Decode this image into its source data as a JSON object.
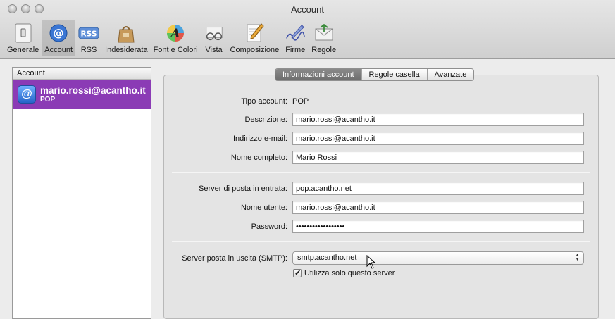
{
  "window": {
    "title": "Account"
  },
  "toolbar": {
    "items": [
      {
        "label": "Generale",
        "icon": "light-switch-icon"
      },
      {
        "label": "Account",
        "icon": "at-sign-icon",
        "selected": true
      },
      {
        "label": "RSS",
        "icon": "rss-icon"
      },
      {
        "label": "Indesiderata",
        "icon": "junk-bag-icon"
      },
      {
        "label": "Font e Colori",
        "icon": "font-colors-icon"
      },
      {
        "label": "Vista",
        "icon": "view-glasses-icon"
      },
      {
        "label": "Composizione",
        "icon": "compose-pencil-icon"
      },
      {
        "label": "Firme",
        "icon": "signature-pen-icon"
      },
      {
        "label": "Regole",
        "icon": "rules-envelope-icon"
      }
    ],
    "rss_badge": "RSS"
  },
  "sidebar": {
    "header": "Account",
    "accounts": [
      {
        "name": "mario.rossi@acantho.it",
        "type": "POP",
        "icon_glyph": "@"
      }
    ]
  },
  "tabs": [
    {
      "label": "Informazioni account",
      "active": true
    },
    {
      "label": "Regole casella",
      "active": false
    },
    {
      "label": "Avanzate",
      "active": false
    }
  ],
  "form": {
    "account_type_label": "Tipo account:",
    "account_type_value": "POP",
    "description_label": "Descrizione:",
    "description_value": "mario.rossi@acantho.it",
    "email_label": "Indirizzo e-mail:",
    "email_value": "mario.rossi@acantho.it",
    "fullname_label": "Nome completo:",
    "fullname_value": "Mario Rossi",
    "incoming_server_label": "Server di posta in entrata:",
    "incoming_server_value": "pop.acantho.net",
    "username_label": "Nome utente:",
    "username_value": "mario.rossi@acantho.it",
    "password_label": "Password:",
    "password_value": "••••••••••••••••••",
    "smtp_label": "Server posta in uscita (SMTP):",
    "smtp_value": "smtp.acantho.net",
    "only_server_label": "Utilizza solo questo server"
  },
  "colors": {
    "selected_account": "#8b3bb5",
    "active_tab": "#7a7a7a"
  }
}
